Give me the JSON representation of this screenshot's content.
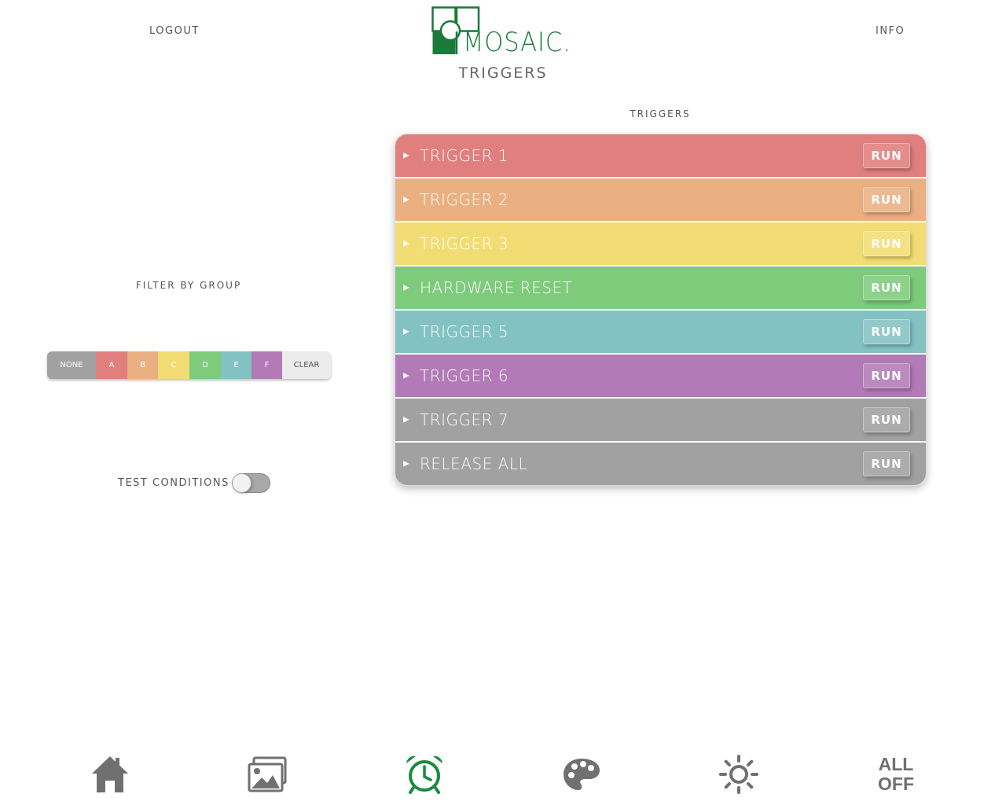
{
  "header": {
    "logout_label": "LOGOUT",
    "info_label": "INFO",
    "logo_text": "MOSAIC.",
    "page_subtitle": "TRIGGERS"
  },
  "triggers_panel": {
    "title": "TRIGGERS",
    "run_label": "RUN",
    "items": [
      {
        "label": "TRIGGER 1",
        "color": "#e07f7e"
      },
      {
        "label": "TRIGGER 2",
        "color": "#ebb082"
      },
      {
        "label": "TRIGGER 3",
        "color": "#f2dd74"
      },
      {
        "label": "HARDWARE RESET",
        "color": "#7ecb7c"
      },
      {
        "label": "TRIGGER 5",
        "color": "#83c2c2"
      },
      {
        "label": "TRIGGER 6",
        "color": "#b27ab6"
      },
      {
        "label": "TRIGGER 7",
        "color": "#a1a1a1"
      },
      {
        "label": "RELEASE ALL",
        "color": "#a1a1a1"
      }
    ]
  },
  "filter": {
    "title": "FILTER BY GROUP",
    "segments": [
      "NONE",
      "A",
      "B",
      "C",
      "D",
      "E",
      "F",
      "CLEAR"
    ]
  },
  "test_conditions": {
    "label": "TEST CONDITIONS",
    "enabled": false
  },
  "bottom_nav": {
    "items": [
      {
        "name": "home",
        "icon": "home-icon",
        "active": false
      },
      {
        "name": "gallery",
        "icon": "image-icon",
        "active": false
      },
      {
        "name": "triggers",
        "icon": "alarm-clock-icon",
        "active": true
      },
      {
        "name": "palette",
        "icon": "palette-icon",
        "active": false
      },
      {
        "name": "brightness",
        "icon": "sun-icon",
        "active": false
      },
      {
        "name": "all-off",
        "icon": "text",
        "active": false
      }
    ],
    "all_off_line1": "ALL",
    "all_off_line2": "OFF"
  },
  "colors": {
    "brand_green": "#1a7a3a",
    "active_nav": "#1a8a3e",
    "inactive_nav": "#707070"
  }
}
